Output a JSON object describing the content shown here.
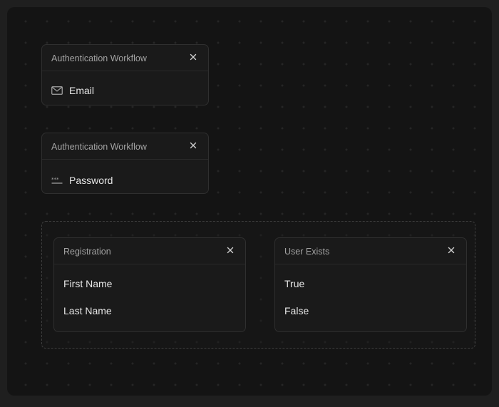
{
  "cards": {
    "email_card": {
      "title": "Authentication Workflow",
      "field_label": "Email",
      "field_icon": "mail-icon"
    },
    "password_card": {
      "title": "Authentication Workflow",
      "field_label": "Password",
      "field_icon": "password-icon"
    },
    "registration_card": {
      "title": "Registration",
      "items": [
        "First Name",
        "Last Name"
      ]
    },
    "user_exists_card": {
      "title": "User Exists",
      "items": [
        "True",
        "False"
      ]
    }
  },
  "icons": {
    "close": "close-icon",
    "mail": "mail-icon",
    "password": "password-icon"
  },
  "colors": {
    "canvas": "#141414",
    "card": "#1a1a1a",
    "border": "#2f2f2f",
    "text": "#e6e6e6",
    "muted": "#a3a3a3"
  }
}
